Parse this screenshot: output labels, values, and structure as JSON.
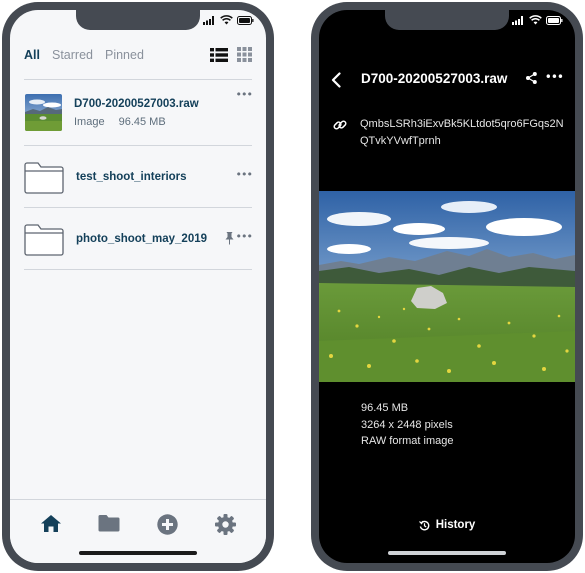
{
  "status": {
    "icons": [
      "signal-icon",
      "wifi-icon",
      "battery-icon"
    ]
  },
  "browser": {
    "tabs": [
      {
        "label": "All",
        "active": true
      },
      {
        "label": "Starred",
        "active": false
      },
      {
        "label": "Pinned",
        "active": false
      }
    ],
    "files": [
      {
        "name": "D700-20200527003.raw",
        "type": "Image",
        "size": "96.45 MB"
      },
      {
        "name": "test_shoot_interiors"
      },
      {
        "name": "photo_shoot_may_2019",
        "pinned": true
      }
    ],
    "more_glyph": "•••"
  },
  "detail": {
    "title": "D700-20200527003.raw",
    "hash": "QmbsLSRh3iExvBk5KLtdot5qro6FGqs2NQTvkYVwfTprnh",
    "size": "96.45 MB",
    "dimensions": "3264 x 2448 pixels",
    "format": "RAW format image",
    "history_label": "History",
    "menu_glyph": "•••"
  },
  "colors": {
    "accent": "#14405a",
    "nav": "#6b7480"
  }
}
